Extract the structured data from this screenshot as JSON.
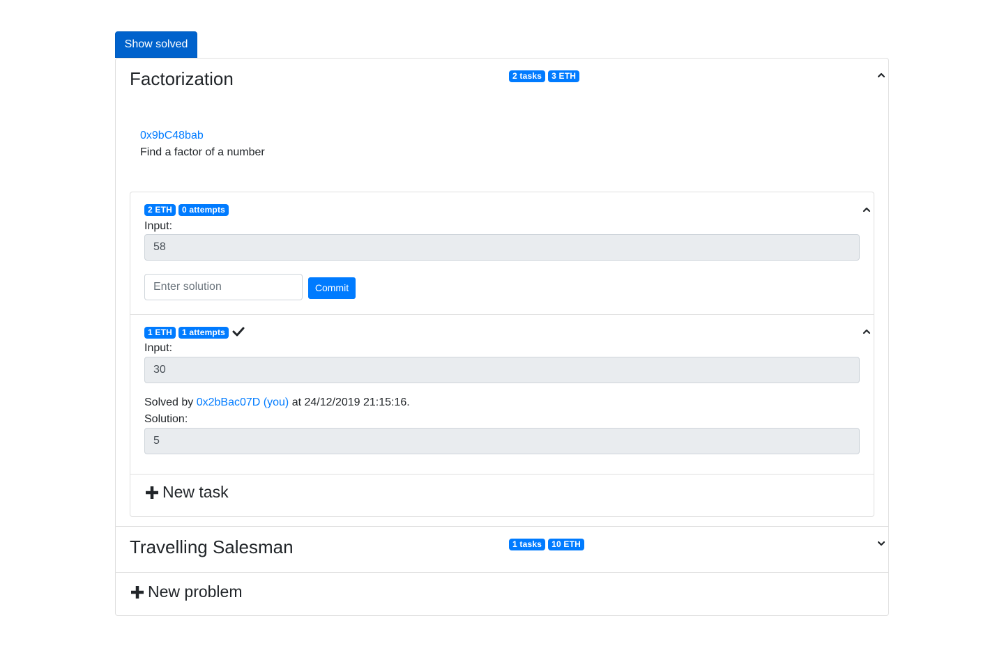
{
  "toolbar": {
    "show_solved_label": "Show solved"
  },
  "problems": [
    {
      "title": "Factorization",
      "badges": [
        "2 tasks",
        "3 ETH"
      ],
      "address": "0x9bC48bab",
      "description": "Find a factor of a number",
      "tasks": [
        {
          "badges": [
            "2 ETH",
            "0 attempts"
          ],
          "input_label": "Input:",
          "input_value": "58",
          "solution_placeholder": "Enter solution",
          "commit_label": "Commit"
        },
        {
          "badges": [
            "1 ETH",
            "1 attempts"
          ],
          "solved_icon": "check-icon",
          "input_label": "Input:",
          "input_value": "30",
          "solved_by_prefix": "Solved by",
          "solver_address": "0x2bBac07D (you)",
          "solved_at": "at 24/12/2019 21:15:16.",
          "solution_label": "Solution:",
          "solution_value": "5"
        }
      ],
      "new_task_label": "New task"
    },
    {
      "title": "Travelling Salesman",
      "badges": [
        "1 tasks",
        "10 ETH"
      ]
    }
  ],
  "new_problem_label": "New problem",
  "icons": {
    "collapse": "chevron-up-icon",
    "expand": "chevron-down-icon",
    "add": "plus-icon"
  },
  "colors": {
    "primary": "#007bff",
    "button_active": "#0062cc",
    "readonly_bg": "#e9ecef"
  }
}
